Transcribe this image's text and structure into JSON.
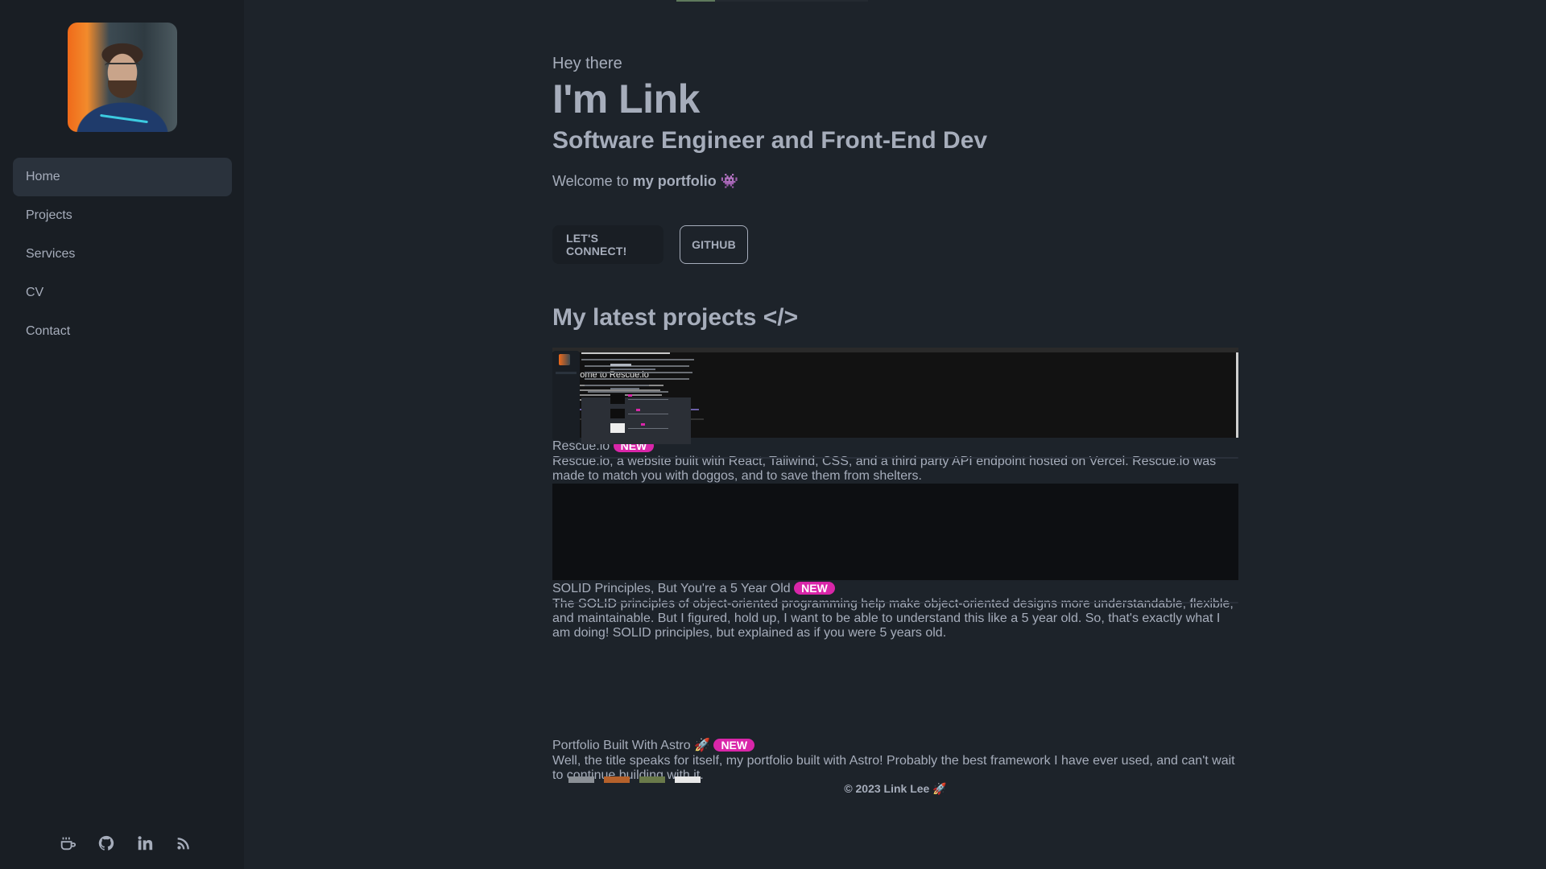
{
  "sidebar": {
    "avatar_alt": "profile-photo",
    "nav": [
      {
        "label": "Home",
        "active": true
      },
      {
        "label": "Projects",
        "active": false
      },
      {
        "label": "Services",
        "active": false
      },
      {
        "label": "CV",
        "active": false
      },
      {
        "label": "Contact",
        "active": false
      }
    ],
    "social_icons": [
      "coffee-icon",
      "github-icon",
      "linkedin-icon",
      "rss-icon"
    ]
  },
  "scroll_progress": 0.2,
  "hero": {
    "greeting": "Hey there",
    "name": "I'm Link",
    "role": "Software Engineer and Front-End Dev",
    "welcome_prefix": "Welcome to ",
    "welcome_bold": "my portfolio",
    "welcome_emoji": "👾",
    "buttons": {
      "connect": "LET'S CONNECT!",
      "github": "GITHUB"
    }
  },
  "projects_section": {
    "title": "My latest projects </>",
    "items": [
      {
        "title": "Rescue.io",
        "badge": "NEW",
        "description": "Rescue.io, a website built with React, Tailwind, CSS, and a third party API endpoint hosted on Vercel. Rescue.io was made to match you with doggos, and to save them from shelters.",
        "thumb_text": "Welcome to Rescue.io"
      },
      {
        "title": "SOLID Principles, But You're a 5 Year Old",
        "badge": "NEW",
        "description": "The SOLID principles of object-oriented programming help make object-oriented designs more understandable, flexible, and maintainable. But I figured, hold up, I want to be able to understand this like a 5 year old. So, that's exactly what I am doing! SOLID principles, but explained as if you were 5 years old."
      },
      {
        "title": "Portfolio Built With Astro 🚀",
        "badge": "NEW",
        "description": "Well, the title speaks for itself, my portfolio built with Astro! Probably the best framework I have ever used, and can't wait to continue building with it."
      }
    ]
  },
  "footer": {
    "text": "© 2023 Link Lee 🚀"
  },
  "colors": {
    "background": "#1d232a",
    "sidebar": "#191e24",
    "active_nav": "#2a323c",
    "text": "#a6adbb",
    "badge": "#d926a9",
    "progress": "#5f7a5c"
  }
}
